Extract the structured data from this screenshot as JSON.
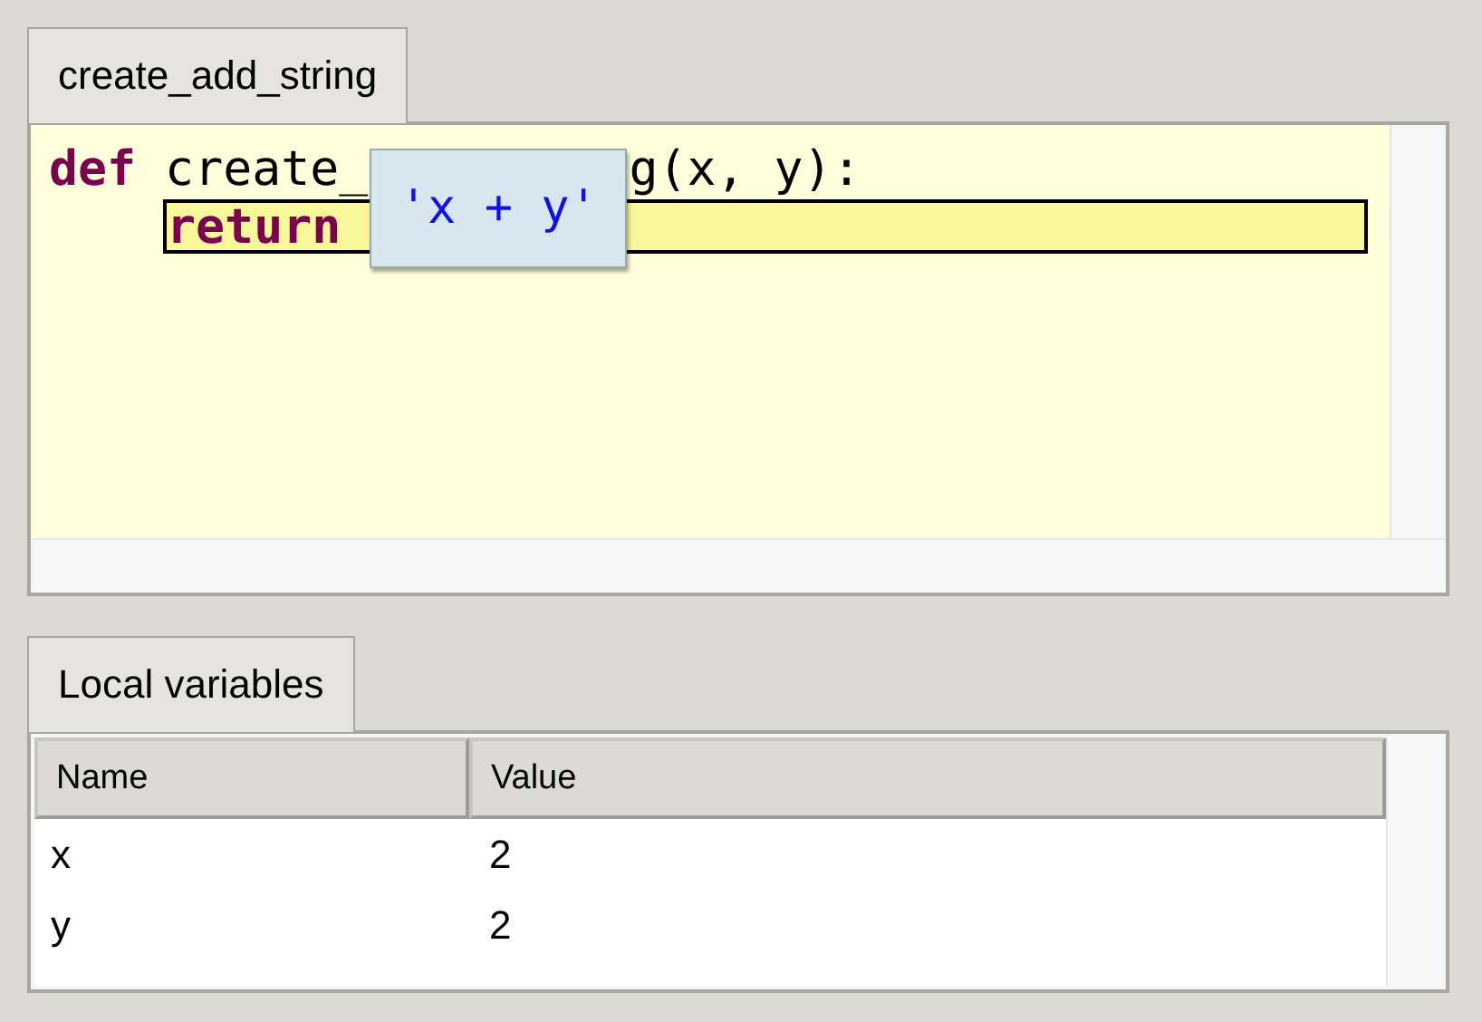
{
  "editor": {
    "tab": {
      "label": "create_add_string"
    },
    "lines": [
      {
        "highlighted": false,
        "indented": false,
        "tokens": [
          {
            "kind": "keyword",
            "text": "def"
          },
          {
            "kind": "plain",
            "text": " create_"
          }
        ],
        "tokens_after_tooltip": [
          {
            "kind": "plain",
            "text": "g(x, y):"
          }
        ]
      },
      {
        "highlighted": true,
        "indented": true,
        "tokens": [
          {
            "kind": "keyword",
            "text": "return"
          }
        ]
      }
    ],
    "tooltip": {
      "text": "'x + y'"
    }
  },
  "variables": {
    "tab": {
      "label": "Local variables"
    },
    "columns": [
      "Name",
      "Value"
    ],
    "rows": [
      [
        "x",
        "2"
      ],
      [
        "y",
        "2"
      ]
    ]
  }
}
